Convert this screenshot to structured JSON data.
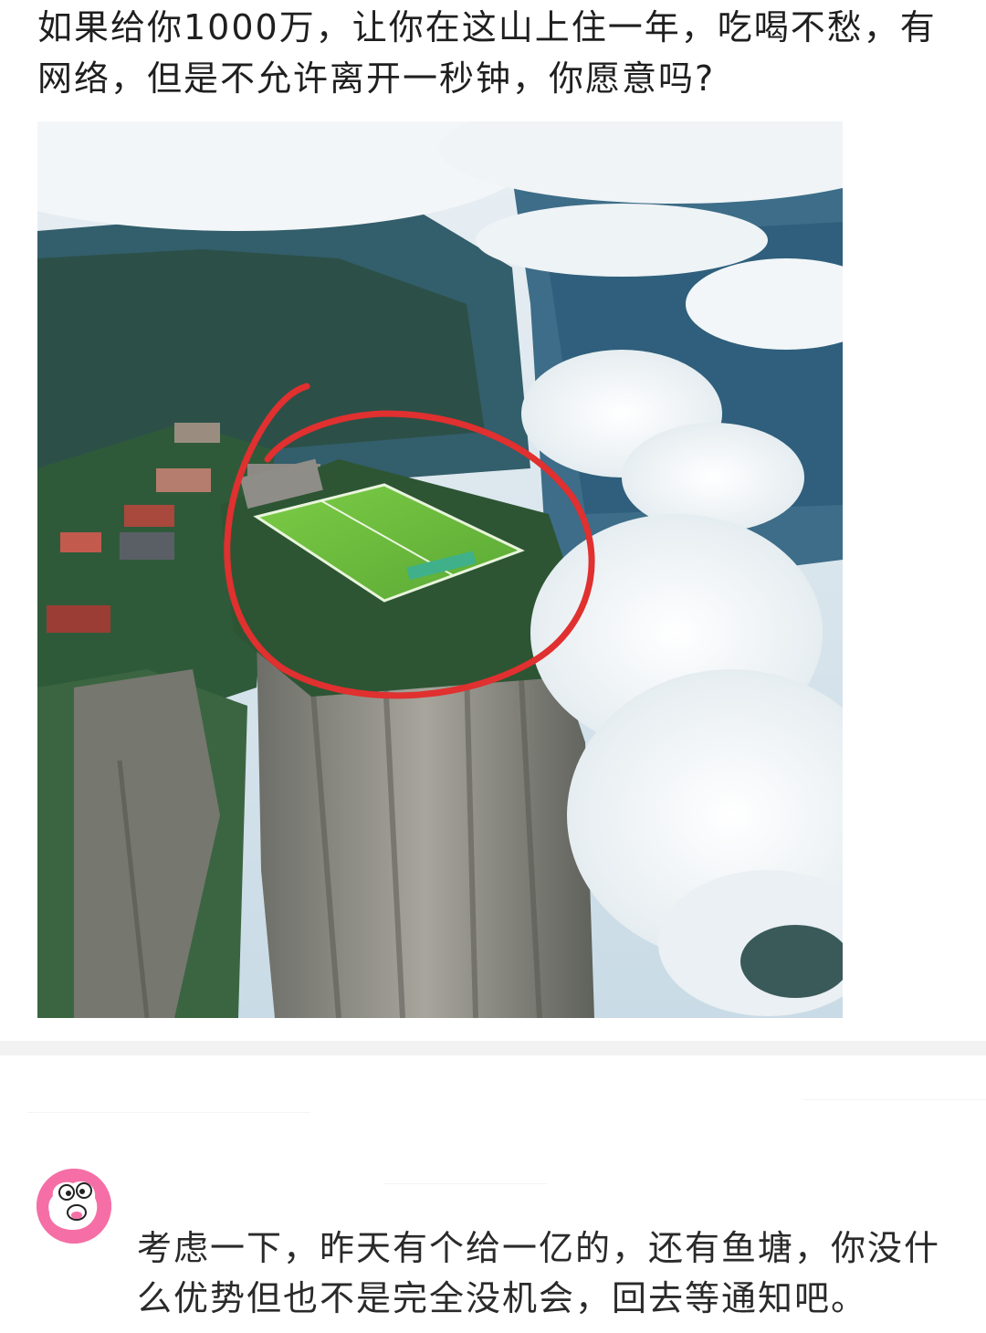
{
  "post": {
    "text": "如果给你1000万，让你在这山上住一年，吃喝不愁，有网络，但是不允许离开一秒钟，你愿意吗?"
  },
  "photo": {
    "icon": "cliff-football-field-photo",
    "colors": {
      "sky": "#dfe8ef",
      "cloud": "#f4f7f9",
      "mountain": "#3f6f86",
      "forest": "#2f5a3a",
      "field": "#6fbf3f",
      "rock": "#8b8a84",
      "circle": "#e0302f"
    }
  },
  "comment": {
    "avatar_icon": "cartoon-face-avatar",
    "avatar_color": "#f56fa6",
    "text": "考虑一下，昨天有个给一亿的，还有鱼塘，你没什么优势但也不是完全没机会，回去等通知吧。"
  }
}
